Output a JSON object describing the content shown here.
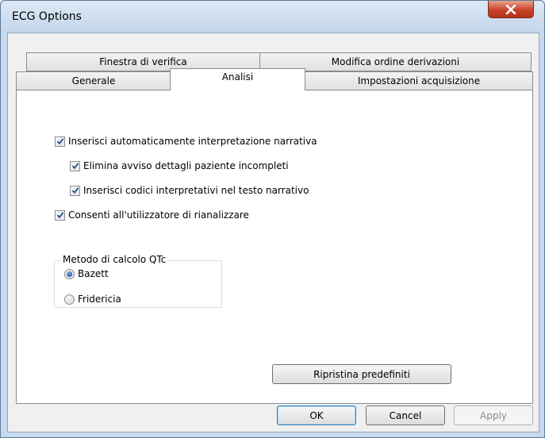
{
  "window": {
    "title": "ECG Options"
  },
  "tabs": {
    "row_back": [
      "Finestra di verifica",
      "Modifica ordine derivazioni"
    ],
    "row_front": [
      "Generale",
      "Analisi",
      "Impostazioni acquisizione"
    ],
    "active": "Analisi"
  },
  "analysis": {
    "checkboxes": [
      {
        "label": "Inserisci automaticamente interpretazione narrativa",
        "checked": true
      },
      {
        "label": "Elimina avviso dettagli paziente incompleti",
        "checked": true
      },
      {
        "label": "Inserisci codici interpretativi nel testo narrativo",
        "checked": true
      },
      {
        "label": "Consenti all'utilizzatore di rianalizzare",
        "checked": true
      }
    ],
    "qtc_group": {
      "legend": "Metodo di calcolo QTc",
      "options": [
        {
          "label": "Bazett",
          "selected": true
        },
        {
          "label": "Fridericia",
          "selected": false
        }
      ]
    },
    "restore_defaults_label": "Ripristina predefiniti"
  },
  "footer": {
    "ok_label": "OK",
    "cancel_label": "Cancel",
    "apply_label": "Apply"
  },
  "icons": {
    "close": "close-icon",
    "check": "checkmark-icon"
  },
  "colors": {
    "titlebar": "#c4d6ea",
    "close_button": "#c7432a",
    "dialog_background": "#f0f0f0",
    "radio_selected": "#1f5fb8",
    "check_color": "#2a4d86"
  }
}
